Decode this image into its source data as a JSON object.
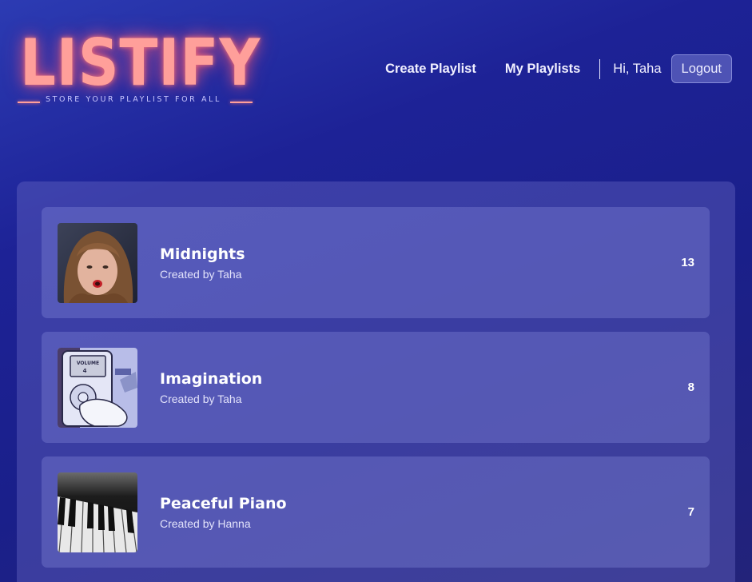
{
  "logo": {
    "title": "LISTIFY",
    "tagline": "STORE YOUR PLAYLIST FOR ALL"
  },
  "nav": {
    "create_playlist": "Create Playlist",
    "my_playlists": "My Playlists",
    "greeting": "Hi, Taha",
    "logout": "Logout"
  },
  "playlists": [
    {
      "name": "Midnights",
      "creator": "Created by Taha",
      "count": "13",
      "cover_icon": "portrait-cover"
    },
    {
      "name": "Imagination",
      "creator": "Created by Taha",
      "count": "8",
      "cover_icon": "ipod-cover"
    },
    {
      "name": "Peaceful Piano",
      "creator": "Created by Hanna",
      "count": "7",
      "cover_icon": "piano-keys-cover"
    }
  ],
  "colors": {
    "logo_neon": "#ff9f9a",
    "background": "#1d2296",
    "card": "#5a5fbf"
  }
}
